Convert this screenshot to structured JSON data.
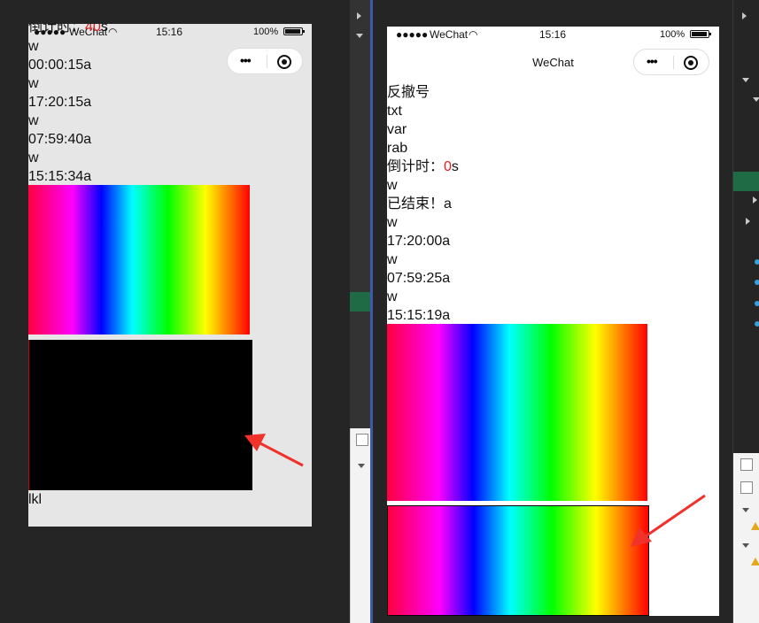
{
  "left_phone": {
    "status": {
      "carrier": "WeChat",
      "time": "15:16",
      "battery": "100%"
    },
    "top_clipped_text": "倒计时：",
    "top_clipped_number": "40",
    "top_clipped_unit": "s",
    "lines": [
      "w",
      "00:00:15a",
      "w",
      "17:20:15a",
      "w",
      "07:59:40a",
      "w",
      "15:15:34a"
    ],
    "footer_text": "lkl"
  },
  "right_phone": {
    "status": {
      "carrier": "WeChat",
      "time": "15:16",
      "battery": "100%"
    },
    "nav_title": "WeChat",
    "lines_before_countdown": [
      "反撤号",
      "txt",
      "var",
      "rab"
    ],
    "countdown_label": "倒计时：",
    "countdown_value": "0",
    "countdown_unit": "s",
    "lines_after_countdown": [
      "w",
      "已结束！a",
      "w",
      "17:20:00a",
      "w",
      "07:59:25a",
      "w",
      "15:15:19a"
    ]
  },
  "colors": {
    "arrow": "#f0322a",
    "countdown_number": "#e02020",
    "ide_accent": "#3c5aa8"
  }
}
